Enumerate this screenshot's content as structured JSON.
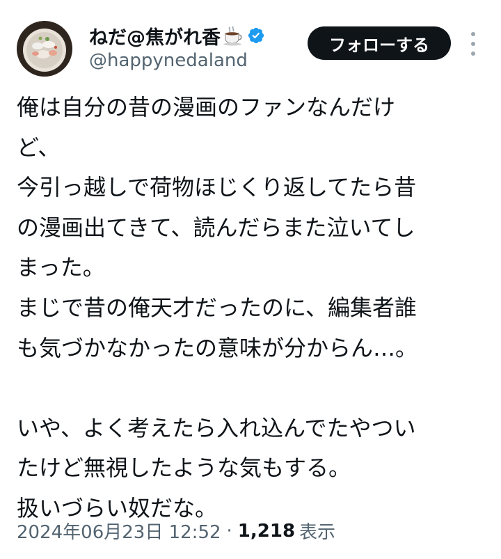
{
  "author": {
    "display_name": "ねだ@焦がれ香",
    "handle": "@happynedaland",
    "badge_icon": "coffee-cup-icon",
    "verified_icon": "verified-badge-icon",
    "verified_color": "#1d9bf0"
  },
  "actions": {
    "follow_label": "フォローする",
    "more_icon": "more-vertical-icon"
  },
  "tweet": {
    "lines": [
      "俺は自分の昔の漫画のファンなんだけ",
      "ど、",
      "今引っ越しで荷物ほじくり返してたら昔",
      "の漫画出てきて、読んだらまた泣いてし",
      "まった。",
      "まじで昔の俺天才だったのに、編集者誰",
      "も気づかなかったの意味が分からん…。",
      "",
      "いや、よく考えたら入れ込んでたやつい",
      "たけど無視したような気もする。",
      "扱いづらい奴だな。"
    ]
  },
  "meta": {
    "timestamp": "2024年06月23日 12:52",
    "separator": "·",
    "views_count": "1,218",
    "views_label": "表示"
  },
  "colors": {
    "text_primary": "#0f1419",
    "text_secondary": "#536471",
    "button_bg": "#0f1419",
    "button_text": "#ffffff"
  }
}
